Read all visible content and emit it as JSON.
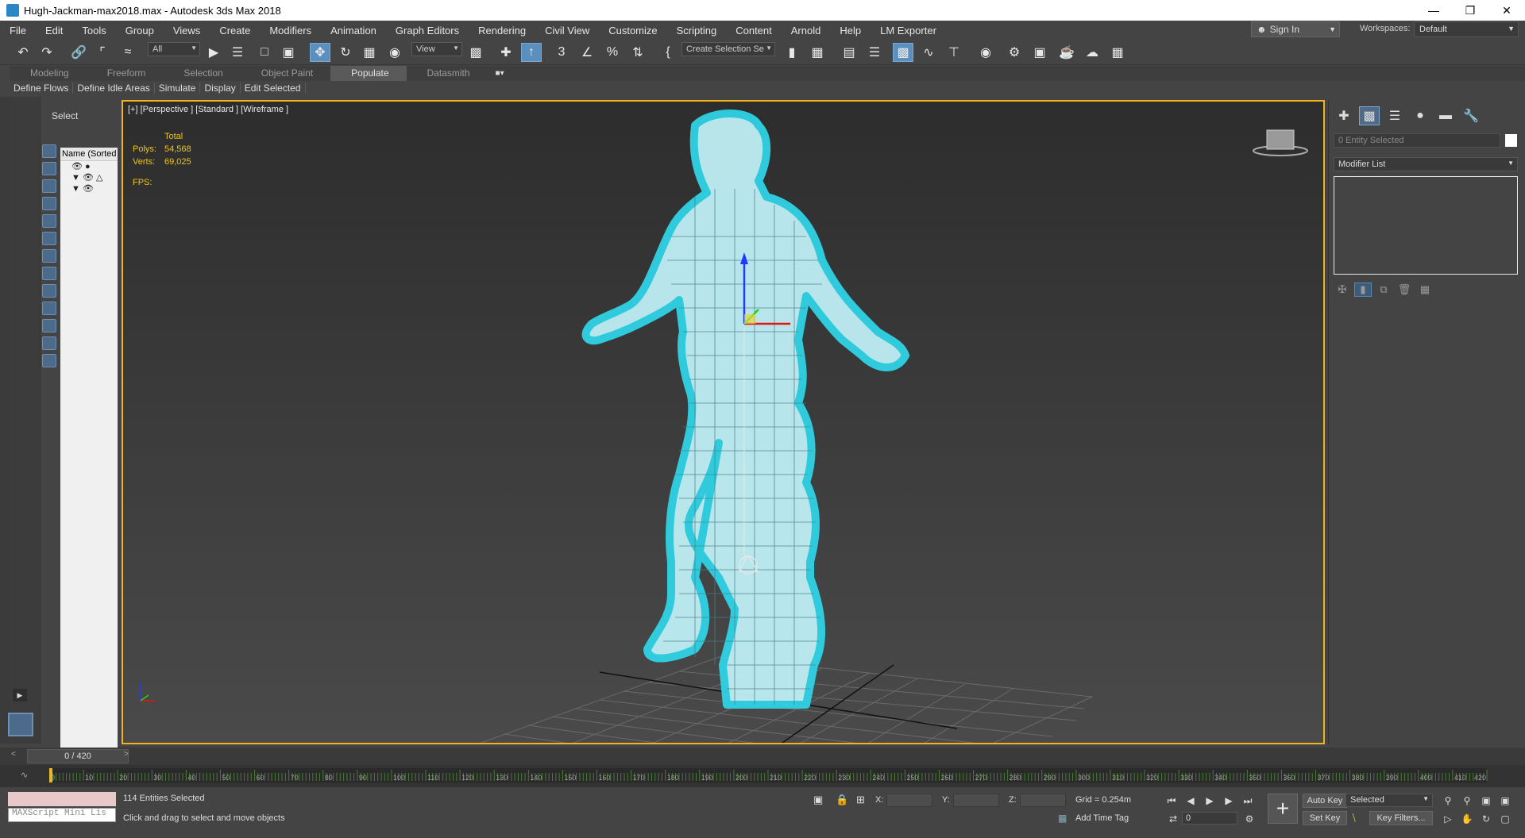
{
  "window": {
    "title": "Hugh-Jackman-max2018.max - Autodesk 3ds Max 2018",
    "minimize": "—",
    "restore": "❐",
    "close": "✕"
  },
  "menu": [
    "File",
    "Edit",
    "Tools",
    "Group",
    "Views",
    "Create",
    "Modifiers",
    "Animation",
    "Graph Editors",
    "Rendering",
    "Civil View",
    "Customize",
    "Scripting",
    "Content",
    "Arnold",
    "Help",
    "LM Exporter"
  ],
  "account": {
    "sign_in": "Sign In",
    "workspaces_label": "Workspaces:",
    "workspace": "Default"
  },
  "toolbar": {
    "selection_filter": "All",
    "ref_coord": "View",
    "named_selection": "Create Selection Se",
    "active_tool": "select-and-move"
  },
  "ribbon": {
    "tabs": [
      "Modeling",
      "Freeform",
      "Selection",
      "Object Paint",
      "Populate",
      "Datasmith"
    ],
    "selected_tab": "Populate",
    "panel_buttons": [
      "Define Flows",
      "Define Idle Areas",
      "Simulate",
      "Display",
      "Edit Selected"
    ]
  },
  "scene_explorer": {
    "header": "Select",
    "column": "Name (Sorted A"
  },
  "viewport": {
    "label": "[+] [Perspective ] [Standard ] [Wireframe ]",
    "stats": {
      "total": "Total",
      "polys_label": "Polys:",
      "polys": "54,568",
      "verts_label": "Verts:",
      "verts": "69,025",
      "fps_label": "FPS:"
    }
  },
  "command_panel": {
    "entity_field": "0 Entity Selected",
    "modifier_list": "Modifier List"
  },
  "timeline": {
    "frame_display": "0 / 420",
    "ticks": [
      "0",
      "10",
      "20",
      "30",
      "40",
      "50",
      "60",
      "70",
      "80",
      "90",
      "100",
      "110",
      "120",
      "130",
      "140",
      "150",
      "160",
      "170",
      "180",
      "190",
      "200",
      "210",
      "220",
      "230",
      "240",
      "250",
      "260",
      "270",
      "280",
      "290",
      "300",
      "310",
      "320",
      "330",
      "340",
      "350",
      "360",
      "370",
      "380",
      "390",
      "400",
      "410",
      "420"
    ]
  },
  "status": {
    "maxscript": "MAXScript Mini Lis",
    "selected": "114 Entities Selected",
    "prompt": "Click and drag to select and move objects",
    "x_label": "X:",
    "y_label": "Y:",
    "z_label": "Z:",
    "grid": "Grid = 0.254m",
    "add_time_tag": "Add Time Tag",
    "auto_key": "Auto Key",
    "set_key": "Set Key",
    "key_mode": "Selected",
    "key_filters": "Key Filters...",
    "current_frame": "0"
  },
  "colors": {
    "viewport_border": "#f3b41b",
    "wireframe": "#d6f6fb",
    "selection_glow": "#2fd3e6",
    "stats_text": "#f1c40f",
    "active_button": "#5b8fbd"
  }
}
